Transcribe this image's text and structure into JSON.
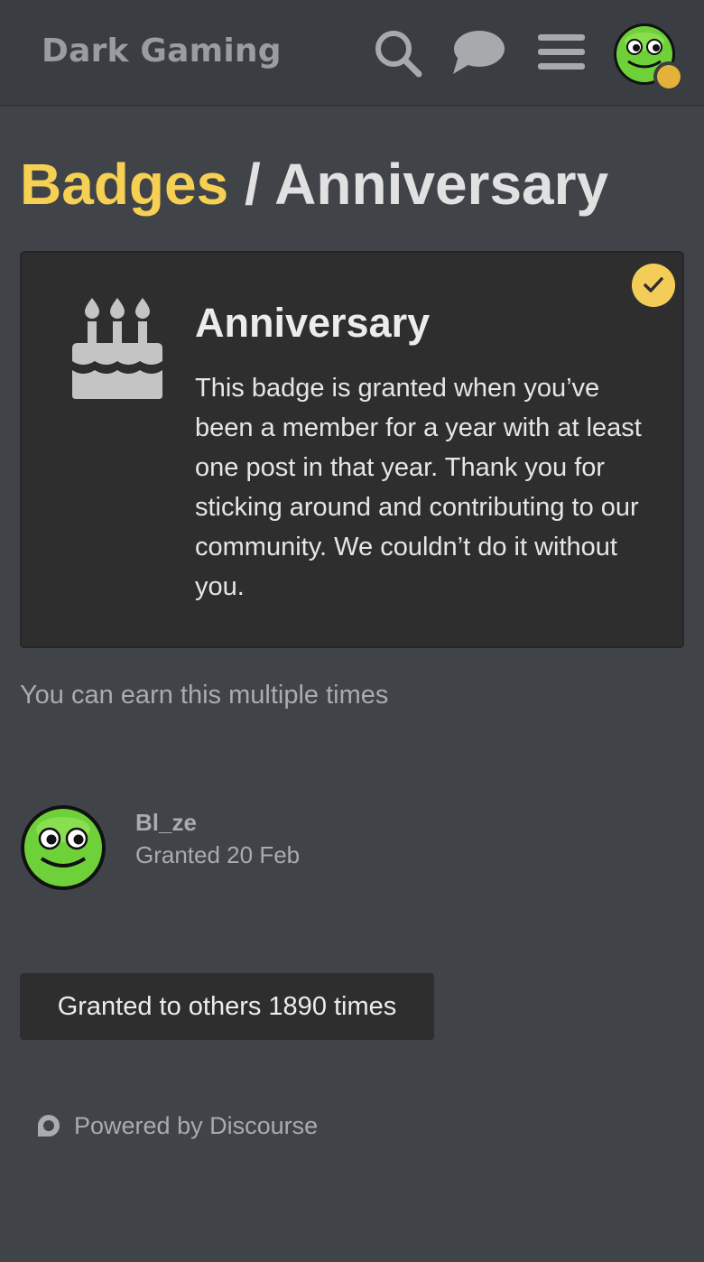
{
  "header": {
    "site_title": "Dark Gaming",
    "icons": [
      "search-icon",
      "chat-icon",
      "menu-icon",
      "avatar"
    ]
  },
  "breadcrumb": {
    "parent": "Badges",
    "separator": " / ",
    "current": "Anniversary"
  },
  "badge": {
    "name": "Anniversary",
    "icon": "birthday-cake-icon",
    "granted_check": "check-icon",
    "description": "This badge is granted when you’ve been a member for a year with at least one post in that year. Thank you for sticking around and contributing to our community. We couldn’t do it without you."
  },
  "multiple_note": "You can earn this multiple times",
  "grant": {
    "username": "Bl_ze",
    "granted": "Granted 20 Feb"
  },
  "others_button": "Granted to others 1890 times",
  "footer": {
    "powered_by": "Powered by Discourse"
  },
  "colors": {
    "background": "#404348",
    "header": "#3a3d42",
    "card": "#2e2e2f",
    "accent_yellow": "#f5d052",
    "avatar_green": "#6fd13a"
  }
}
